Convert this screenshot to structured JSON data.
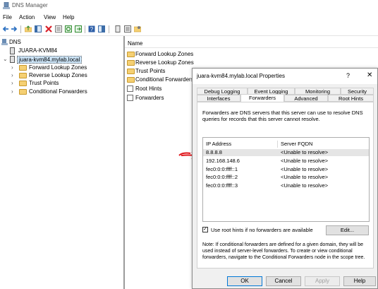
{
  "window": {
    "title": "DNS Manager"
  },
  "menu": {
    "items": [
      "File",
      "Action",
      "View",
      "Help"
    ]
  },
  "tree": {
    "root": "DNS",
    "server_1": "JUARA-KVM84",
    "server_2": "juara-kvm84.mylab.local",
    "children": [
      "Forward Lookup Zones",
      "Reverse Lookup Zones",
      "Trust Points",
      "Conditional Forwarders"
    ]
  },
  "list": {
    "column_name": "Name",
    "items": [
      "Forward Lookup Zones",
      "Reverse Lookup Zones",
      "Trust Points",
      "Conditional Forwarders",
      "Root Hints",
      "Forwarders"
    ]
  },
  "dialog": {
    "title": "juara-kvm84.mylab.local Properties",
    "help": "?",
    "close": "✕",
    "tabs_row1": [
      "Debug Logging",
      "Event Logging",
      "Monitoring",
      "Security"
    ],
    "tabs_row2": [
      "Interfaces",
      "Forwarders",
      "Advanced",
      "Root Hints"
    ],
    "active_tab": "Forwarders",
    "description": "Forwarders are DNS servers that this server can use to resolve DNS queries for records that this server cannot resolve.",
    "columns": {
      "ip": "IP Address",
      "fqdn": "Server FQDN"
    },
    "forwarders": [
      {
        "ip": "8.8.8.8",
        "fqdn": "<Unable to resolve>"
      },
      {
        "ip": "192.168.148.6",
        "fqdn": "<Unable to resolve>"
      },
      {
        "ip": "fec0:0:0:ffff::1",
        "fqdn": "<Unable to resolve>"
      },
      {
        "ip": "fec0:0:0:ffff::2",
        "fqdn": "<Unable to resolve>"
      },
      {
        "ip": "fec0:0:0:ffff::3",
        "fqdn": "<Unable to resolve>"
      }
    ],
    "use_root_hints_label": "Use root hints if no forwarders are available",
    "use_root_hints_checked": true,
    "edit_label": "Edit...",
    "note": "Note: If conditional forwarders are defined for a given domain, they will be used instead of server-level forwarders.  To create or view conditional forwarders, navigate to the Conditional Forwarders node in the scope tree.",
    "buttons": {
      "ok": "OK",
      "cancel": "Cancel",
      "apply": "Apply",
      "help": "Help"
    }
  },
  "colors": {
    "annotation_red": "#e0161b",
    "tab_underline": "#e0161b"
  }
}
